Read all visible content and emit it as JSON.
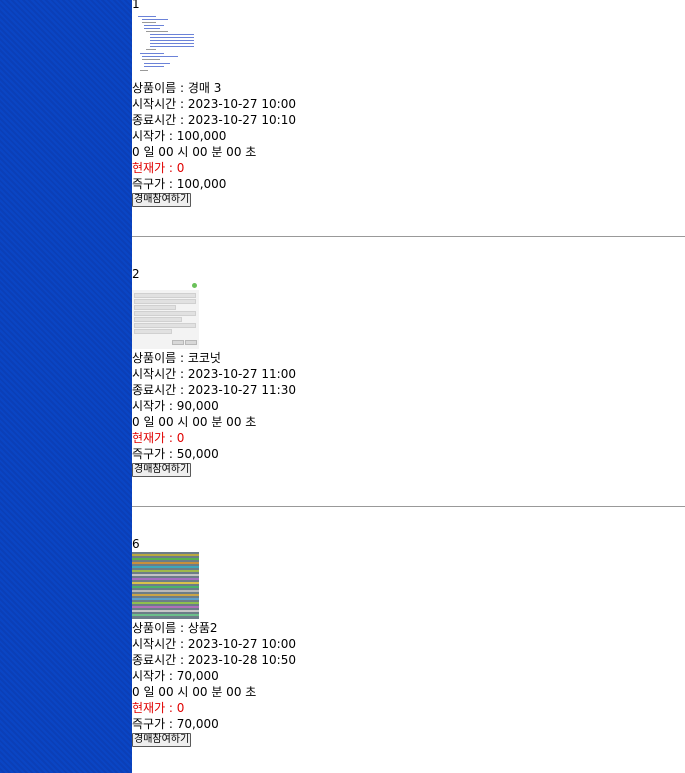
{
  "items": [
    {
      "number": "1",
      "name": "상품이름 : 경매 3",
      "start": "시작시간 : 2023-10-27 10:00",
      "end": "종료시간 : 2023-10-27 10:10",
      "start_price": "시작가 : 100,000",
      "countdown": "0 일 00 시 00 분 00 초",
      "current_price": "현재가 : 0",
      "instant_price": "즉구가 : 100,000",
      "button": "경매참여하기"
    },
    {
      "number": "2",
      "name": "상품이름 : 코코넛",
      "start": "시작시간 : 2023-10-27 11:00",
      "end": "종료시간 : 2023-10-27 11:30",
      "start_price": "시작가 : 90,000",
      "countdown": "0 일 00 시 00 분 00 초",
      "current_price": "현재가 : 0",
      "instant_price": "즉구가 : 50,000",
      "button": "경매참여하기"
    },
    {
      "number": "6",
      "name": "상품이름 : 상품2",
      "start": "시작시간 : 2023-10-27 10:00",
      "end": "종료시간 : 2023-10-28 10:50",
      "start_price": "시작가 : 70,000",
      "countdown": "0 일 00 시 00 분 00 초",
      "current_price": "현재가 : 0",
      "instant_price": "즉구가 : 70,000",
      "button": "경매참여하기"
    }
  ],
  "colors": {
    "sidebar": "#0a45c4",
    "current_price": "#e00000",
    "divider": "#999999"
  }
}
